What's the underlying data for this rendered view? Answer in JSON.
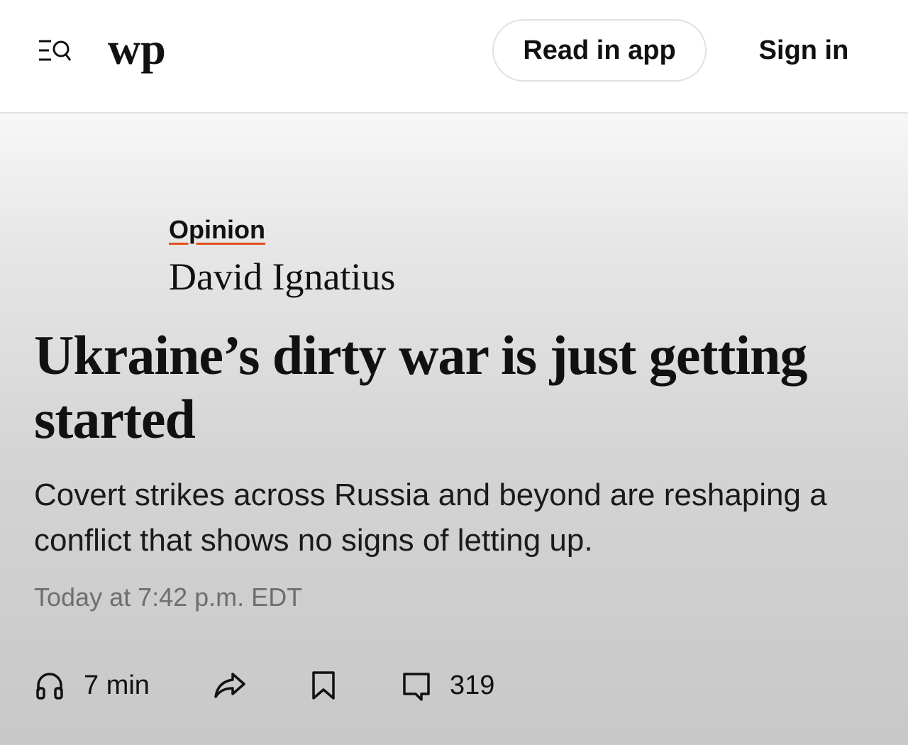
{
  "header": {
    "logo_text": "wp",
    "read_in_app_label": "Read in app",
    "sign_in_label": "Sign in",
    "menu_icon": "menu-search-icon"
  },
  "article": {
    "kicker": "Opinion",
    "author": "David Ignatius",
    "headline": "Ukraine’s dirty war is just getting started",
    "dek": "Covert strikes across Russia and beyond are reshaping a conflict that shows no signs of letting up.",
    "timestamp": "Today at 7:42 p.m. EDT"
  },
  "actions": {
    "listen_icon": "headphones-icon",
    "listen_label": "7 min",
    "share_icon": "share-icon",
    "save_icon": "bookmark-icon",
    "comments_icon": "comment-icon",
    "comments_count": "319"
  },
  "colors": {
    "kicker_underline": "#e0521f",
    "timestamp": "#6e6e6e",
    "hero_top": "#f7f7f7",
    "hero_bottom": "#c8c8c8"
  }
}
